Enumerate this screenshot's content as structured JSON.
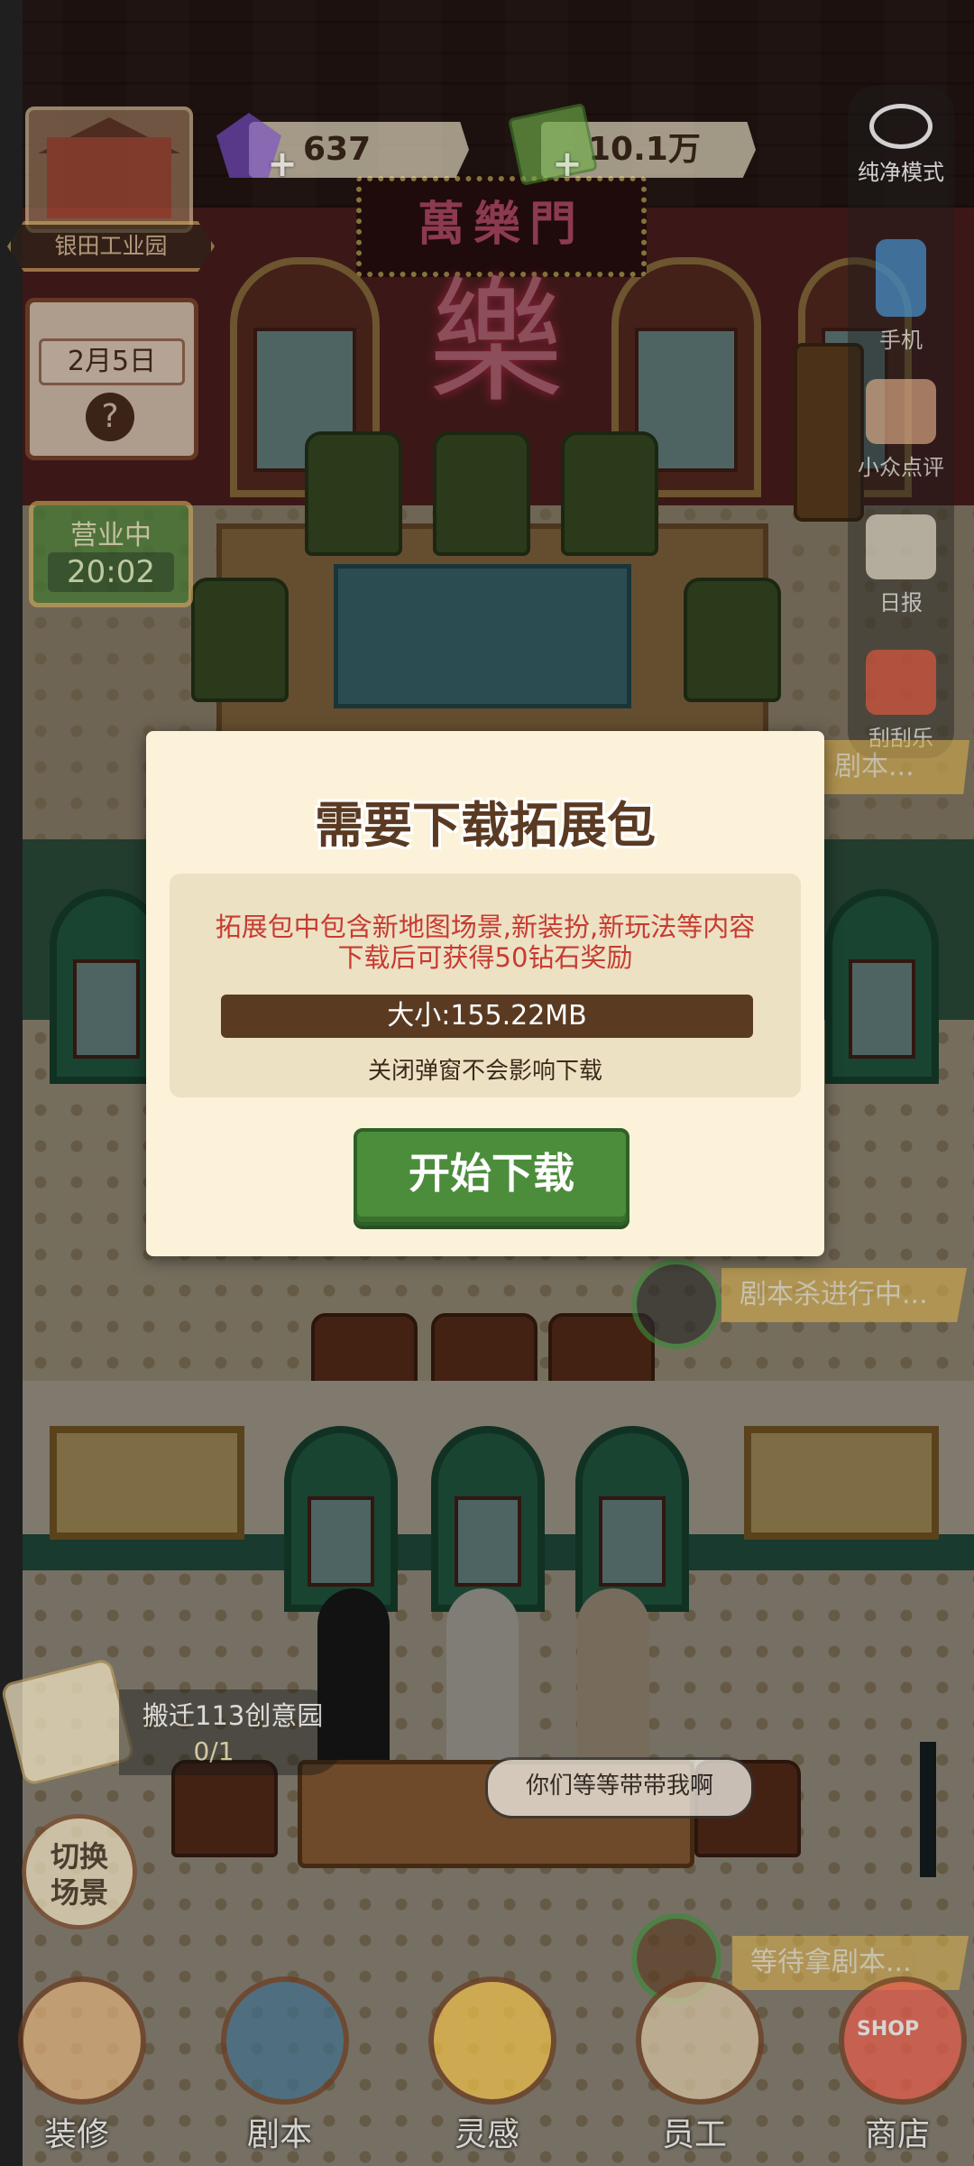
{
  "hud": {
    "location_name": "银田工业园",
    "diamonds": "637",
    "cash": "10.1万",
    "date": "2月5日",
    "date_hint": "?",
    "business_status": "营业中",
    "business_time": "20:02",
    "plus_symbol": "+"
  },
  "venue_sign": {
    "title": "萬樂門",
    "big_char": "樂"
  },
  "side_menu": [
    {
      "label": "纯净模式",
      "icon": "eye-icon"
    },
    {
      "label": "手机",
      "icon": "phone-icon"
    },
    {
      "label": "小众点评",
      "icon": "thumbs-up-icon"
    },
    {
      "label": "日报",
      "icon": "newspaper-icon"
    },
    {
      "label": "刮刮乐",
      "icon": "scratch-card-icon"
    }
  ],
  "status_tags": {
    "floor1": "剧本...",
    "floor2": "剧本杀进行中...",
    "floor3": "等待拿剧本..."
  },
  "quest": {
    "title": "搬迁113创意园",
    "progress": "0/1"
  },
  "speech_bubble": "你们等等带带我啊",
  "switch_scene": "切换\n场景",
  "bottom_nav": [
    {
      "label": "装修",
      "icon": "house-icon"
    },
    {
      "label": "剧本",
      "icon": "script-book-icon"
    },
    {
      "label": "灵感",
      "icon": "lightbulb-icon"
    },
    {
      "label": "员工",
      "icon": "employee-card-icon"
    },
    {
      "label": "商店",
      "icon": "shop-icon",
      "badge": "SHOP"
    }
  ],
  "dialog": {
    "title": "需要下载拓展包",
    "message_line1": "拓展包中包含新地图场景,新装扮,新玩法等内容",
    "message_line2": "下载后可获得50钻石奖励",
    "size": "大小:155.22MB",
    "note": "关闭弹窗不会影响下载",
    "button": "开始下载"
  },
  "colors": {
    "dialog_bg": "#fbf2d9",
    "accent_green": "#4c8d3c",
    "message_red": "#c73b31",
    "size_bar": "#5a3b22"
  }
}
